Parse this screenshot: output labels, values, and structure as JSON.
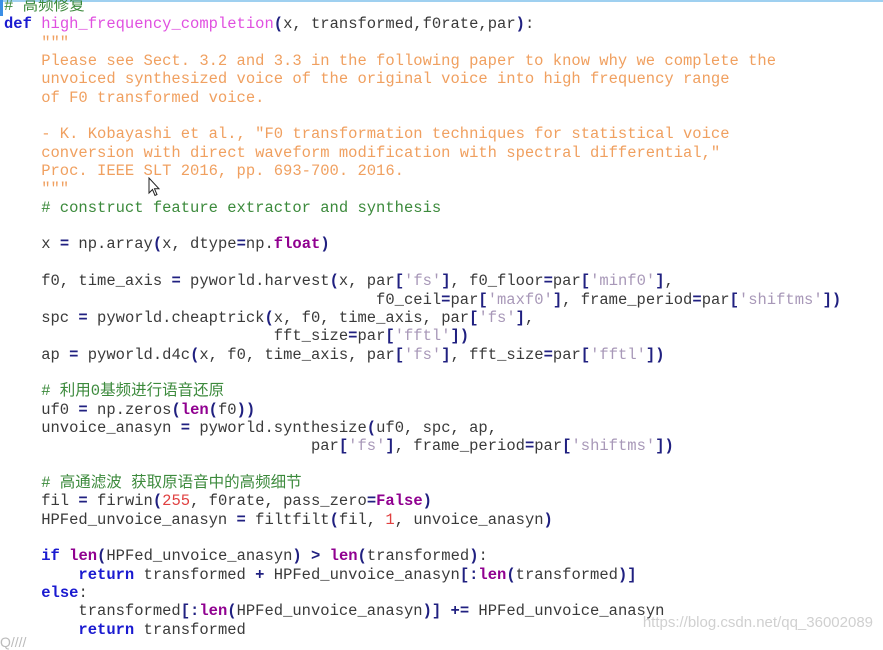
{
  "editor": {
    "lines": [
      [
        [
          "cm",
          "# 高频修复"
        ]
      ],
      [
        [
          "kw",
          "def"
        ],
        [
          "p",
          " "
        ],
        [
          "fn",
          "high_frequency_completion"
        ],
        [
          "op",
          "("
        ],
        [
          "p",
          "x, transformed,f0rate,par"
        ],
        [
          "op",
          ")"
        ],
        [
          "p",
          ":"
        ]
      ],
      [
        [
          "doc",
          "    \"\"\""
        ]
      ],
      [
        [
          "doc",
          "    Please see Sect. 3.2 and 3.3 in the following paper to know why we complete the"
        ]
      ],
      [
        [
          "doc",
          "    unvoiced synthesized voice of the original voice into high frequency range"
        ]
      ],
      [
        [
          "doc",
          "    of F0 transformed voice."
        ]
      ],
      [
        [
          "p",
          ""
        ]
      ],
      [
        [
          "doc",
          "    - K. Kobayashi et al., \"F0 transformation techniques for statistical voice"
        ]
      ],
      [
        [
          "doc",
          "    conversion with direct waveform modification with spectral differential,\""
        ]
      ],
      [
        [
          "doc",
          "    Proc. IEEE SLT 2016, pp. 693-700. 2016."
        ]
      ],
      [
        [
          "doc",
          "    \"\"\""
        ]
      ],
      [
        [
          "cm",
          "    # construct feature extractor and synthesis"
        ]
      ],
      [
        [
          "p",
          ""
        ]
      ],
      [
        [
          "p",
          "    x "
        ],
        [
          "op",
          "="
        ],
        [
          "p",
          " np.array"
        ],
        [
          "op",
          "("
        ],
        [
          "p",
          "x, dtype"
        ],
        [
          "op",
          "="
        ],
        [
          "p",
          "np."
        ],
        [
          "bi",
          "float"
        ],
        [
          "op",
          ")"
        ]
      ],
      [
        [
          "p",
          ""
        ]
      ],
      [
        [
          "p",
          "    f0, time_axis "
        ],
        [
          "op",
          "="
        ],
        [
          "p",
          " pyworld.harvest"
        ],
        [
          "op",
          "("
        ],
        [
          "p",
          "x, par"
        ],
        [
          "op",
          "["
        ],
        [
          "str",
          "'fs'"
        ],
        [
          "op",
          "]"
        ],
        [
          "p",
          ", f0_floor"
        ],
        [
          "op",
          "="
        ],
        [
          "p",
          "par"
        ],
        [
          "op",
          "["
        ],
        [
          "str",
          "'minf0'"
        ],
        [
          "op",
          "]"
        ],
        [
          "p",
          ","
        ]
      ],
      [
        [
          "p",
          "                                        f0_ceil"
        ],
        [
          "op",
          "="
        ],
        [
          "p",
          "par"
        ],
        [
          "op",
          "["
        ],
        [
          "str",
          "'maxf0'"
        ],
        [
          "op",
          "]"
        ],
        [
          "p",
          ", frame_period"
        ],
        [
          "op",
          "="
        ],
        [
          "p",
          "par"
        ],
        [
          "op",
          "["
        ],
        [
          "str",
          "'shiftms'"
        ],
        [
          "op",
          "])"
        ]
      ],
      [
        [
          "p",
          "    spc "
        ],
        [
          "op",
          "="
        ],
        [
          "p",
          " pyworld.cheaptrick"
        ],
        [
          "op",
          "("
        ],
        [
          "p",
          "x, f0, time_axis, par"
        ],
        [
          "op",
          "["
        ],
        [
          "str",
          "'fs'"
        ],
        [
          "op",
          "]"
        ],
        [
          "p",
          ","
        ]
      ],
      [
        [
          "p",
          "                             fft_size"
        ],
        [
          "op",
          "="
        ],
        [
          "p",
          "par"
        ],
        [
          "op",
          "["
        ],
        [
          "str",
          "'fftl'"
        ],
        [
          "op",
          "])"
        ]
      ],
      [
        [
          "p",
          "    ap "
        ],
        [
          "op",
          "="
        ],
        [
          "p",
          " pyworld.d4c"
        ],
        [
          "op",
          "("
        ],
        [
          "p",
          "x, f0, time_axis, par"
        ],
        [
          "op",
          "["
        ],
        [
          "str",
          "'fs'"
        ],
        [
          "op",
          "]"
        ],
        [
          "p",
          ", fft_size"
        ],
        [
          "op",
          "="
        ],
        [
          "p",
          "par"
        ],
        [
          "op",
          "["
        ],
        [
          "str",
          "'fftl'"
        ],
        [
          "op",
          "])"
        ]
      ],
      [
        [
          "p",
          ""
        ]
      ],
      [
        [
          "cm",
          "    # 利用0基频进行语音还原"
        ]
      ],
      [
        [
          "p",
          "    uf0 "
        ],
        [
          "op",
          "="
        ],
        [
          "p",
          " np.zeros"
        ],
        [
          "op",
          "("
        ],
        [
          "bi",
          "len"
        ],
        [
          "op",
          "("
        ],
        [
          "p",
          "f0"
        ],
        [
          "op",
          "))"
        ]
      ],
      [
        [
          "p",
          "    unvoice_anasyn "
        ],
        [
          "op",
          "="
        ],
        [
          "p",
          " pyworld.synthesize"
        ],
        [
          "op",
          "("
        ],
        [
          "p",
          "uf0, spc, ap,"
        ]
      ],
      [
        [
          "p",
          "                                 par"
        ],
        [
          "op",
          "["
        ],
        [
          "str",
          "'fs'"
        ],
        [
          "op",
          "]"
        ],
        [
          "p",
          ", frame_period"
        ],
        [
          "op",
          "="
        ],
        [
          "p",
          "par"
        ],
        [
          "op",
          "["
        ],
        [
          "str",
          "'shiftms'"
        ],
        [
          "op",
          "])"
        ]
      ],
      [
        [
          "p",
          ""
        ]
      ],
      [
        [
          "cm",
          "    # 高通滤波 获取原语音中的高频细节"
        ]
      ],
      [
        [
          "p",
          "    fil "
        ],
        [
          "op",
          "="
        ],
        [
          "p",
          " firwin"
        ],
        [
          "op",
          "("
        ],
        [
          "num",
          "255"
        ],
        [
          "p",
          ", f0rate, pass_zero"
        ],
        [
          "op",
          "="
        ],
        [
          "bi",
          "False"
        ],
        [
          "op",
          ")"
        ]
      ],
      [
        [
          "p",
          "    HPFed_unvoice_anasyn "
        ],
        [
          "op",
          "="
        ],
        [
          "p",
          " filtfilt"
        ],
        [
          "op",
          "("
        ],
        [
          "p",
          "fil, "
        ],
        [
          "num",
          "1"
        ],
        [
          "p",
          ", unvoice_anasyn"
        ],
        [
          "op",
          ")"
        ]
      ],
      [
        [
          "p",
          ""
        ]
      ],
      [
        [
          "p",
          "    "
        ],
        [
          "kw",
          "if"
        ],
        [
          "p",
          " "
        ],
        [
          "bi",
          "len"
        ],
        [
          "op",
          "("
        ],
        [
          "p",
          "HPFed_unvoice_anasyn"
        ],
        [
          "op",
          ")"
        ],
        [
          "p",
          " "
        ],
        [
          "op",
          ">"
        ],
        [
          "p",
          " "
        ],
        [
          "bi",
          "len"
        ],
        [
          "op",
          "("
        ],
        [
          "p",
          "transformed"
        ],
        [
          "op",
          ")"
        ],
        [
          "p",
          ":"
        ]
      ],
      [
        [
          "p",
          "        "
        ],
        [
          "kw",
          "return"
        ],
        [
          "p",
          " transformed "
        ],
        [
          "op",
          "+"
        ],
        [
          "p",
          " HPFed_unvoice_anasyn"
        ],
        [
          "op",
          "[:"
        ],
        [
          "bi",
          "len"
        ],
        [
          "op",
          "("
        ],
        [
          "p",
          "transformed"
        ],
        [
          "op",
          ")]"
        ]
      ],
      [
        [
          "p",
          "    "
        ],
        [
          "kw",
          "else"
        ],
        [
          "p",
          ":"
        ]
      ],
      [
        [
          "p",
          "        transformed"
        ],
        [
          "op",
          "[:"
        ],
        [
          "bi",
          "len"
        ],
        [
          "op",
          "("
        ],
        [
          "p",
          "HPFed_unvoice_anasyn"
        ],
        [
          "op",
          ")]"
        ],
        [
          "p",
          " "
        ],
        [
          "op",
          "+="
        ],
        [
          "p",
          " HPFed_unvoice_anasyn"
        ]
      ],
      [
        [
          "p",
          "        "
        ],
        [
          "kw",
          "return"
        ],
        [
          "p",
          " transformed"
        ]
      ]
    ]
  },
  "watermark": "https://blog.csdn.net/qq_36002089",
  "partial_text": "Q////",
  "colors": {
    "keyword": "#1a1ad0",
    "function_name": "#e050e0",
    "docstring": "#f0a060",
    "comment": "#3c8a3c",
    "builtin": "#900090",
    "number": "#e04040"
  },
  "icons": {
    "cursor": "mouse-pointer-icon"
  }
}
